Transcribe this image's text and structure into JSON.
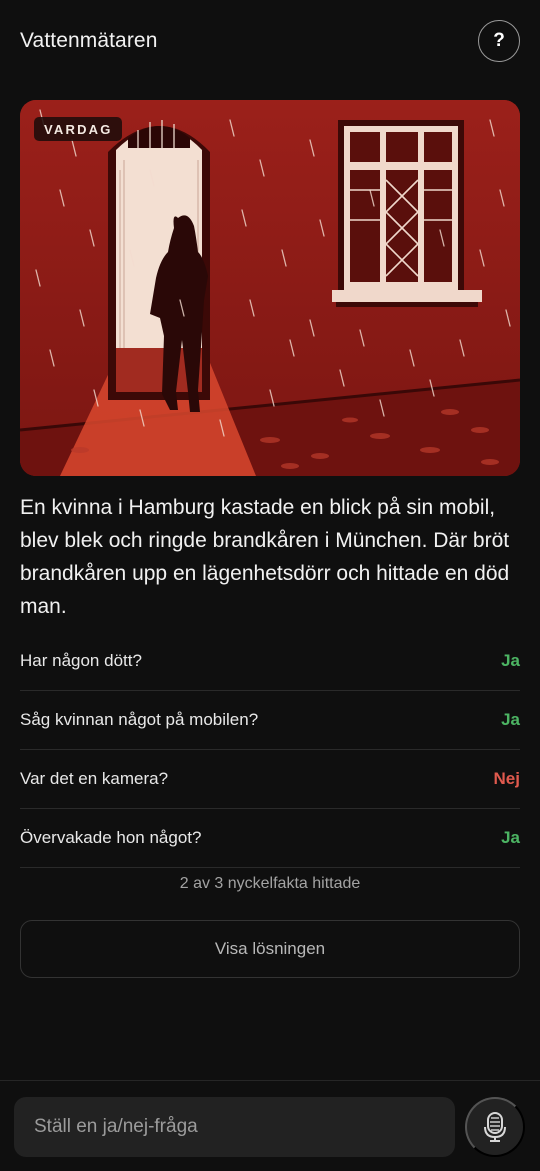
{
  "header": {
    "title": "Vattenmätaren",
    "help_label": "?"
  },
  "hero": {
    "tag": "VARDAG"
  },
  "story": "En kvinna i Hamburg kastade en blick på sin mobil, blev blek och ringde brandkåren i München. Där bröt brandkåren upp en lägenhetsdörr och hittade en död man.",
  "questions": [
    {
      "q": "Har någon dött?",
      "a": "Ja",
      "color": "#4cb463"
    },
    {
      "q": "Såg kvinnan något på mobilen?",
      "a": "Ja",
      "color": "#4cb463"
    },
    {
      "q": "Var det en kamera?",
      "a": "Nej",
      "color": "#e05a4e"
    },
    {
      "q": "Övervakade hon något?",
      "a": "Ja",
      "color": "#4cb463"
    }
  ],
  "progress": "2 av 3 nyckelfakta hittade",
  "solution_button": "Visa lösningen",
  "input": {
    "placeholder": "Ställ en ja/nej-fråga",
    "value": ""
  },
  "icons": {
    "help": "question-icon",
    "mic": "microphone-icon"
  },
  "colors": {
    "background": "#0f0f0f",
    "yes": "#4cb463",
    "no": "#e05a4e",
    "illustration_red": "#8e1a16"
  }
}
